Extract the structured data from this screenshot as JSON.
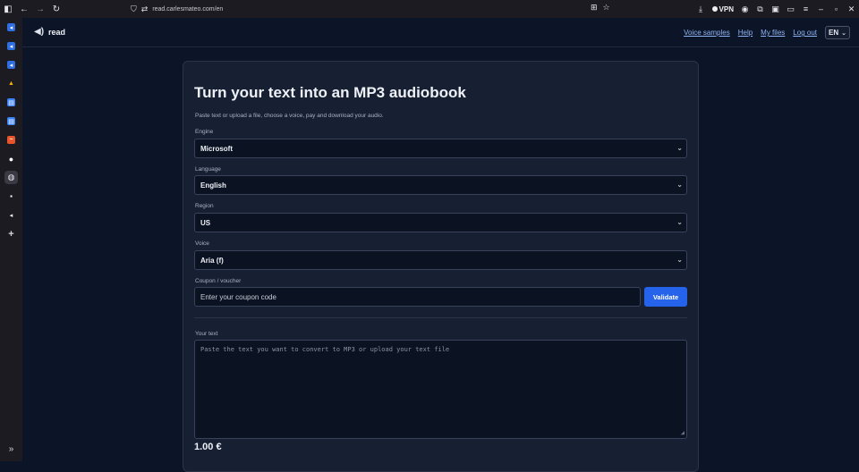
{
  "browser": {
    "url": "read.carlesmateo.com/en",
    "vpn_label": "VPN"
  },
  "app": {
    "logo_text": "read",
    "nav": {
      "voice_samples": "Voice samples",
      "help": "Help",
      "my_files": "My files",
      "log_out": "Log out",
      "language": "EN"
    }
  },
  "form": {
    "title": "Turn your text into an MP3 audiobook",
    "subtitle": "Paste text or upload a file, choose a voice, pay and download your audio.",
    "engine_label": "Engine",
    "engine_value": "Microsoft",
    "language_label": "Language",
    "language_value": "English",
    "region_label": "Region",
    "region_value": "US",
    "voice_label": "Voice",
    "voice_value": "Aria (f)",
    "coupon_label": "Coupon / voucher",
    "coupon_placeholder": "Enter your coupon code",
    "validate_label": "Validate",
    "text_label": "Your text",
    "text_placeholder": "Paste the text you want to convert to MP3 or upload your text file",
    "price": "1.00 €"
  },
  "colors": {
    "background": "#0c1527",
    "card": "#172033",
    "accent": "#2563eb",
    "link": "#8fb4f3"
  }
}
